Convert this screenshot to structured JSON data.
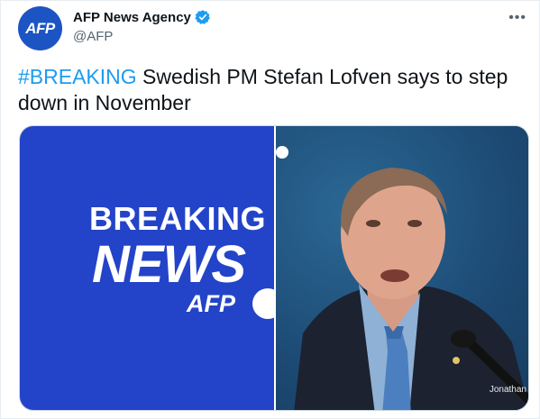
{
  "tweet": {
    "author_name": "AFP News Agency",
    "author_handle": "@AFP",
    "avatar_text": "AFP",
    "more_label": "•••",
    "hashtag": "#BREAKING",
    "text": " Swedish PM Stefan Lofven says to step down in November"
  },
  "media": {
    "left_image": {
      "line1": "BREAKING",
      "line2": "NEWS",
      "brand": "AFP"
    },
    "right_image": {
      "credit": "Jonathan"
    }
  },
  "colors": {
    "brand_blue": "#2344c8",
    "link": "#1d9bf0",
    "verified": "#1d9bf0"
  }
}
